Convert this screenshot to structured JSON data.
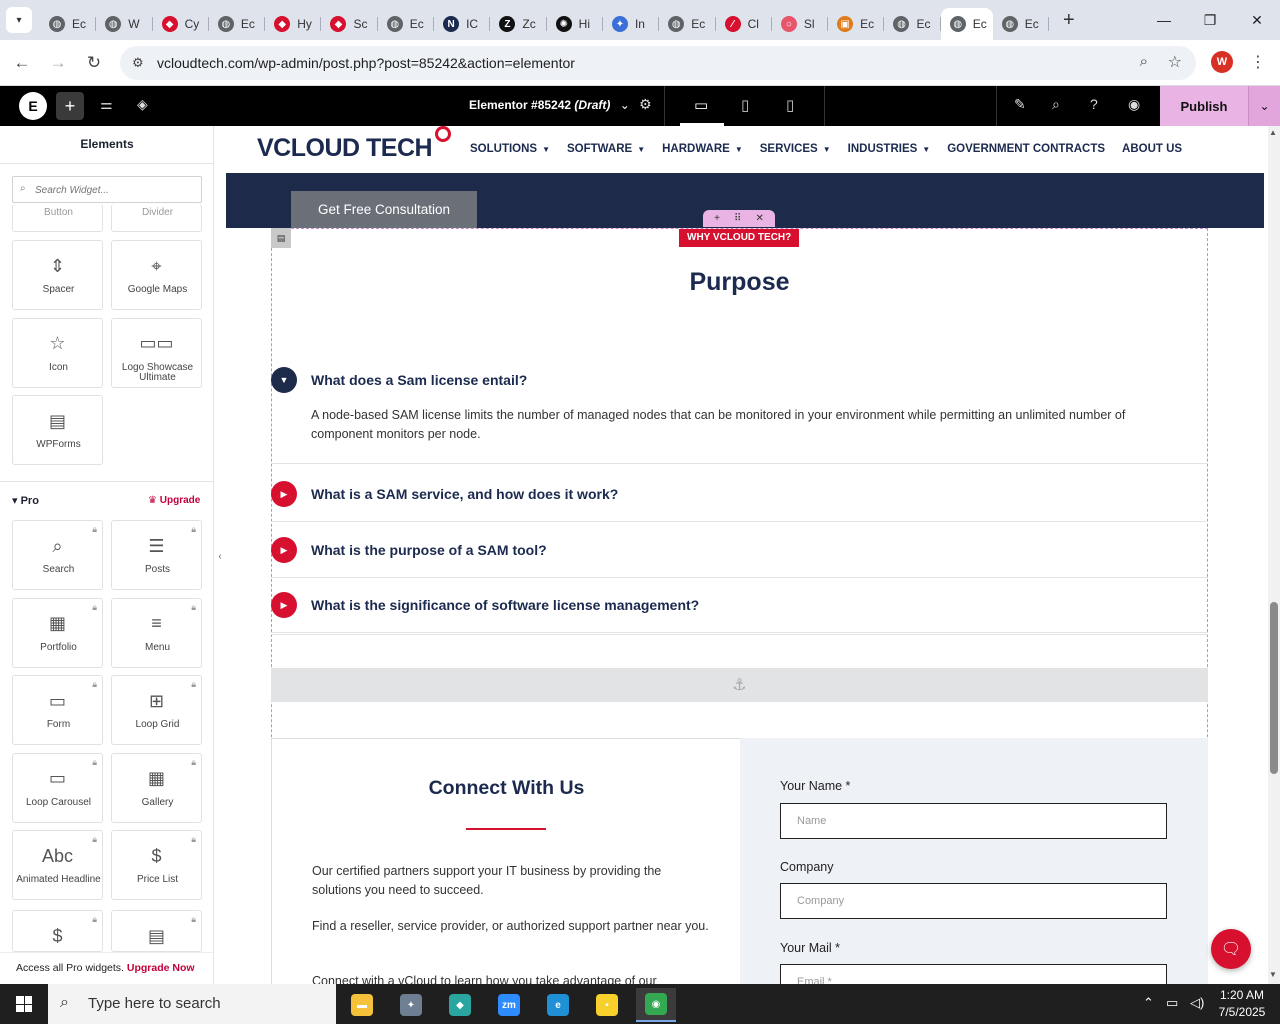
{
  "browser": {
    "tabs": [
      {
        "label": "Ec",
        "icon": "globe-icon",
        "color": "#5f6368"
      },
      {
        "label": "W",
        "icon": "globe-icon",
        "color": "#5f6368"
      },
      {
        "label": "Cy",
        "icon": "diamond-icon",
        "color": "#d6102e"
      },
      {
        "label": "Ec",
        "icon": "globe-icon",
        "color": "#5f6368"
      },
      {
        "label": "Hy",
        "icon": "diamond-icon",
        "color": "#d6102e"
      },
      {
        "label": "Sc",
        "icon": "diamond-icon",
        "color": "#d6102e"
      },
      {
        "label": "Ec",
        "icon": "globe-icon",
        "color": "#5f6368"
      },
      {
        "label": "IC",
        "icon": "n-icon",
        "color": "#1b2a4e"
      },
      {
        "label": "Zc",
        "icon": "z-icon",
        "color": "#111111"
      },
      {
        "label": "Hi",
        "icon": "openai-icon",
        "color": "#111111"
      },
      {
        "label": "In",
        "icon": "bird-icon",
        "color": "#3b6fd8"
      },
      {
        "label": "Ec",
        "icon": "globe-icon",
        "color": "#5f6368"
      },
      {
        "label": "Cl",
        "icon": "slash-icon",
        "color": "#d6102e"
      },
      {
        "label": "Sl",
        "icon": "ring-icon",
        "color": "#e8556b"
      },
      {
        "label": "Ec",
        "icon": "box-icon",
        "color": "#e07b1a"
      },
      {
        "label": "Ec",
        "icon": "globe-icon",
        "color": "#5f6368"
      },
      {
        "label": "Ec",
        "icon": "globe-icon",
        "color": "#5f6368",
        "active": true
      },
      {
        "label": "Ec",
        "icon": "globe-icon",
        "color": "#5f6368"
      }
    ],
    "url": "vcloudtech.com/wp-admin/post.php?post=85242&action=elementor",
    "profile_initial": "W"
  },
  "elementor": {
    "doc_title": "Elementor #85242",
    "doc_status": "(Draft)",
    "publish_label": "Publish",
    "accent": "#e9b4e4"
  },
  "panel": {
    "title": "Elements",
    "search_placeholder": "Search Widget...",
    "partial_labels": [
      "Button",
      "Divider"
    ],
    "basic_widgets": [
      {
        "label": "Spacer",
        "icon": "spacer-icon"
      },
      {
        "label": "Google Maps",
        "icon": "map-icon"
      },
      {
        "label": "Icon",
        "icon": "star-icon"
      },
      {
        "label": "Logo Showcase Ultimate",
        "icon": "logo-showcase-icon"
      },
      {
        "label": "WPForms",
        "icon": "wpforms-icon"
      }
    ],
    "pro_label": "Pro",
    "upgrade_label": "Upgrade",
    "pro_widgets": [
      {
        "label": "Search",
        "icon": "search-widget-icon"
      },
      {
        "label": "Posts",
        "icon": "posts-icon"
      },
      {
        "label": "Portfolio",
        "icon": "portfolio-icon"
      },
      {
        "label": "Menu",
        "icon": "menu-icon"
      },
      {
        "label": "Form",
        "icon": "form-icon"
      },
      {
        "label": "Loop Grid",
        "icon": "loop-grid-icon"
      },
      {
        "label": "Loop Carousel",
        "icon": "loop-carousel-icon"
      },
      {
        "label": "Gallery",
        "icon": "gallery-icon"
      },
      {
        "label": "Animated Headline",
        "icon": "animated-headline-icon"
      },
      {
        "label": "Price List",
        "icon": "price-list-icon"
      }
    ],
    "footer_text": "Access all Pro widgets.",
    "footer_link": "Upgrade Now"
  },
  "site": {
    "logo_main": "VCLOUD",
    "logo_accent": "TECH",
    "nav": [
      {
        "label": "SOLUTIONS",
        "dropdown": true
      },
      {
        "label": "SOFTWARE",
        "dropdown": true
      },
      {
        "label": "HARDWARE",
        "dropdown": true
      },
      {
        "label": "SERVICES",
        "dropdown": true
      },
      {
        "label": "INDUSTRIES",
        "dropdown": true
      },
      {
        "label": "GOVERNMENT CONTRACTS",
        "dropdown": false
      },
      {
        "label": "ABOUT US",
        "dropdown": false
      }
    ],
    "consult_button": "Get Free Consultation",
    "tagline": "WHY VCLOUD TECH?",
    "purpose_title": "Purpose",
    "faq": [
      {
        "q": "What does a Sam license entail?",
        "open": true,
        "a": "A node-based SAM license limits the number of managed nodes that can be monitored in your environment while permitting an unlimited number of component monitors per node."
      },
      {
        "q": "What is a SAM service, and how does it work?",
        "open": false
      },
      {
        "q": "What is the purpose of a SAM tool?",
        "open": false
      },
      {
        "q": "What is the significance of software license management?",
        "open": false
      }
    ],
    "connect_title": "Connect With Us",
    "connect_paragraphs": [
      "Our certified partners support your IT business by providing the solutions you need to succeed.",
      "Find a reseller, service provider, or authorized support partner near you.",
      "Connect with a vCloud to learn how you take advantage of our"
    ],
    "form": {
      "name_label": "Your Name *",
      "name_placeholder": "Name",
      "company_label": "Company",
      "company_placeholder": "Company",
      "mail_label": "Your Mail *",
      "mail_placeholder": "Email *"
    },
    "brand_navy": "#1e2a4a",
    "brand_red": "#d6102e"
  },
  "taskbar": {
    "search_placeholder": "Type here to search",
    "apps": [
      {
        "name": "file-explorer-icon",
        "color": "#f3c13a",
        "glyph": "▬"
      },
      {
        "name": "app-bird-icon",
        "color": "#6e7f93",
        "glyph": "✦"
      },
      {
        "name": "app-diamond-icon",
        "color": "#2aa5a0",
        "glyph": "◆"
      },
      {
        "name": "zoom-icon",
        "color": "#2d8cff",
        "glyph": "zm"
      },
      {
        "name": "edge-icon",
        "color": "#1f8fd6",
        "glyph": "e"
      },
      {
        "name": "sticky-notes-icon",
        "color": "#f7d02c",
        "glyph": "▪"
      },
      {
        "name": "chrome-icon",
        "color": "#34a853",
        "glyph": "◉",
        "active": true
      }
    ],
    "time": "1:20 AM",
    "date": "7/5/2025"
  }
}
